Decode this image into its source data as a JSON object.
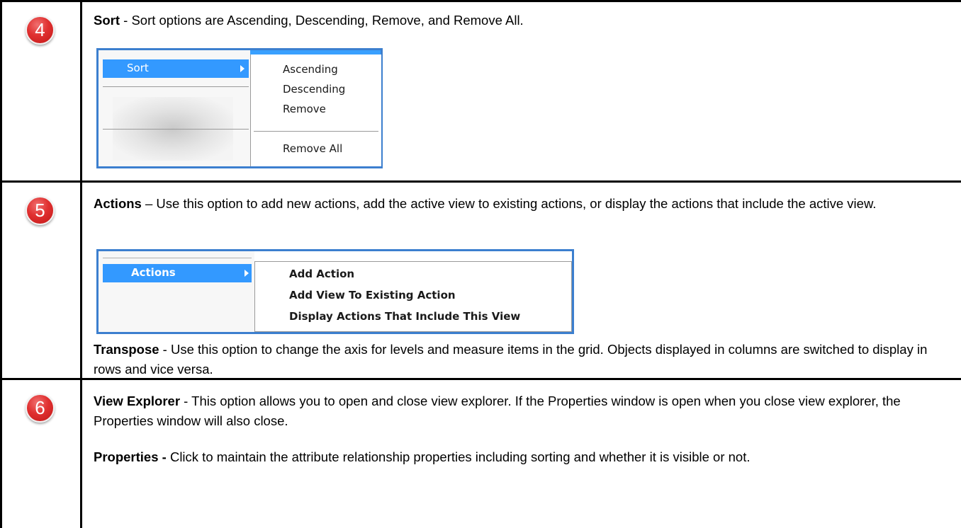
{
  "sections": [
    {
      "number": "4",
      "title": "Sort",
      "text": " - Sort options are Ascending, Descending, Remove, and Remove All.",
      "menu": {
        "highlighted": "Sort",
        "submenu": [
          "Ascending",
          "Descending",
          "Remove",
          "Remove All"
        ]
      }
    },
    {
      "number": "5",
      "title": "Actions",
      "text": " – Use this option to add new actions, add the active view to existing actions, or display the actions that include the active view.",
      "menu": {
        "highlighted": "Actions",
        "submenu": [
          "Add Action",
          "Add View To Existing Action",
          "Display Actions That Include This View"
        ]
      },
      "extra_title": "Transpose",
      "extra_text": " - Use this option to change the axis for levels and measure items in the grid. Objects displayed in columns are switched to display in rows and vice versa."
    },
    {
      "number": "6",
      "title": "View Explorer",
      "text": " - This option allows you to open and close view explorer. If the Properties window is open when you close view explorer, the Properties window will also close.",
      "extra_title": "Properties -",
      "extra_text": " Click to maintain the attribute relationship properties including sorting and whether it is visible or not."
    }
  ],
  "colors": {
    "badge": "#e03030",
    "menu_highlight": "#3399ff",
    "frame": "#3c7fcf"
  }
}
